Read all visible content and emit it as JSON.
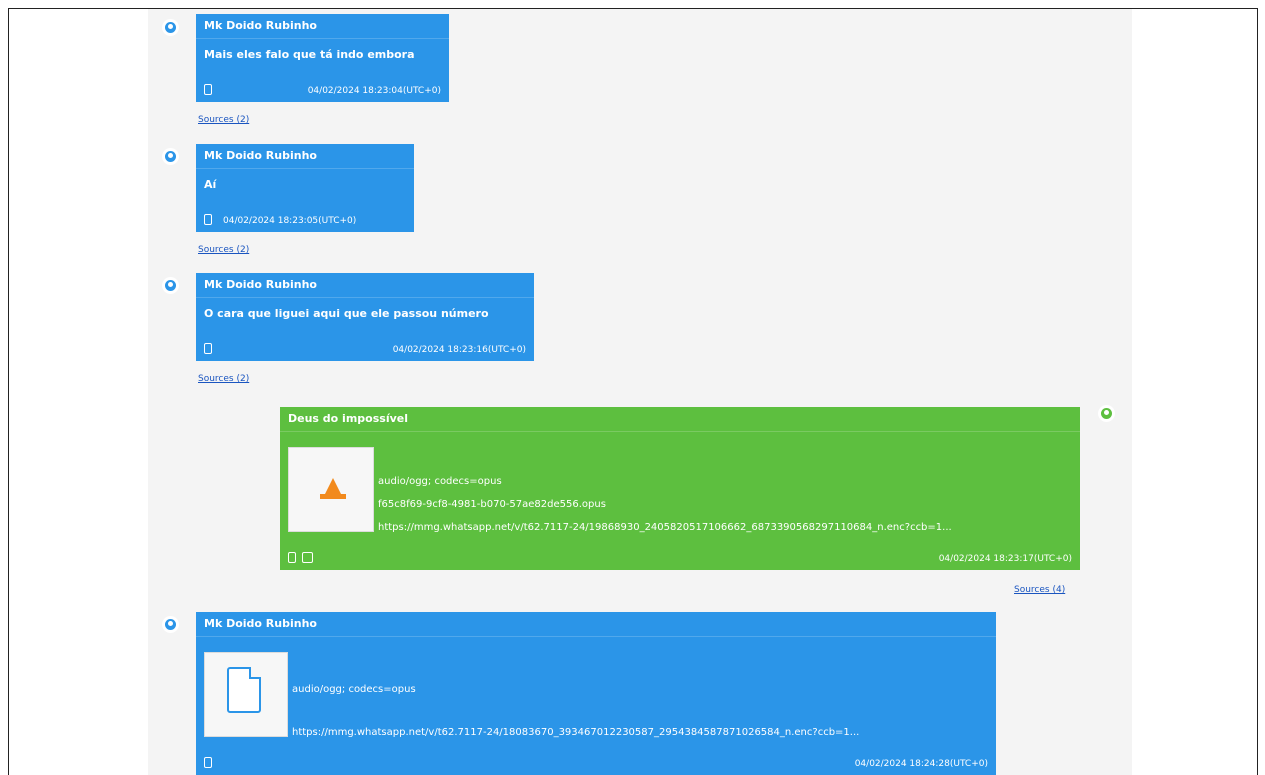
{
  "messages": [
    {
      "sender": "Mk Doido Rubinho",
      "text": "Mais eles falo que tá indo embora",
      "time": "04/02/2024 18:23:04(UTC+0)",
      "sources": "Sources (2)"
    },
    {
      "sender": "Mk Doido Rubinho",
      "text": "Aí",
      "time": "04/02/2024 18:23:05(UTC+0)",
      "sources": "Sources (2)"
    },
    {
      "sender": "Mk Doido Rubinho",
      "text": "O cara que liguei aqui que ele passou número",
      "time": "04/02/2024 18:23:16(UTC+0)",
      "sources": "Sources (2)"
    },
    {
      "sender": "Deus do impossível",
      "attachment": {
        "mime": "audio/ogg; codecs=opus",
        "filename": "f65c8f69-9cf8-4981-b070-57ae82de556.opus",
        "url": "https://mmg.whatsapp.net/v/t62.7117-24/19868930_2405820517106662_6873390568297110684_n.enc?ccb=1..."
      },
      "time": "04/02/2024 18:23:17(UTC+0)",
      "sources": "Sources (4)"
    },
    {
      "sender": "Mk Doido Rubinho",
      "attachment": {
        "mime": "audio/ogg; codecs=opus",
        "url": "https://mmg.whatsapp.net/v/t62.7117-24/18083670_393467012230587_2954384587871026584_n.enc?ccb=1..."
      },
      "time": "04/02/2024 18:24:28(UTC+0)"
    }
  ],
  "colors": {
    "incoming": "#2b95e8",
    "outgoing": "#5dbf3f",
    "link": "#1a55c0"
  },
  "icons": {
    "avatar": "user-avatar-icon",
    "device": "phone-icon",
    "media": "media-icon",
    "audio_thumb": "vlc-cone-icon",
    "file_thumb": "document-icon"
  }
}
